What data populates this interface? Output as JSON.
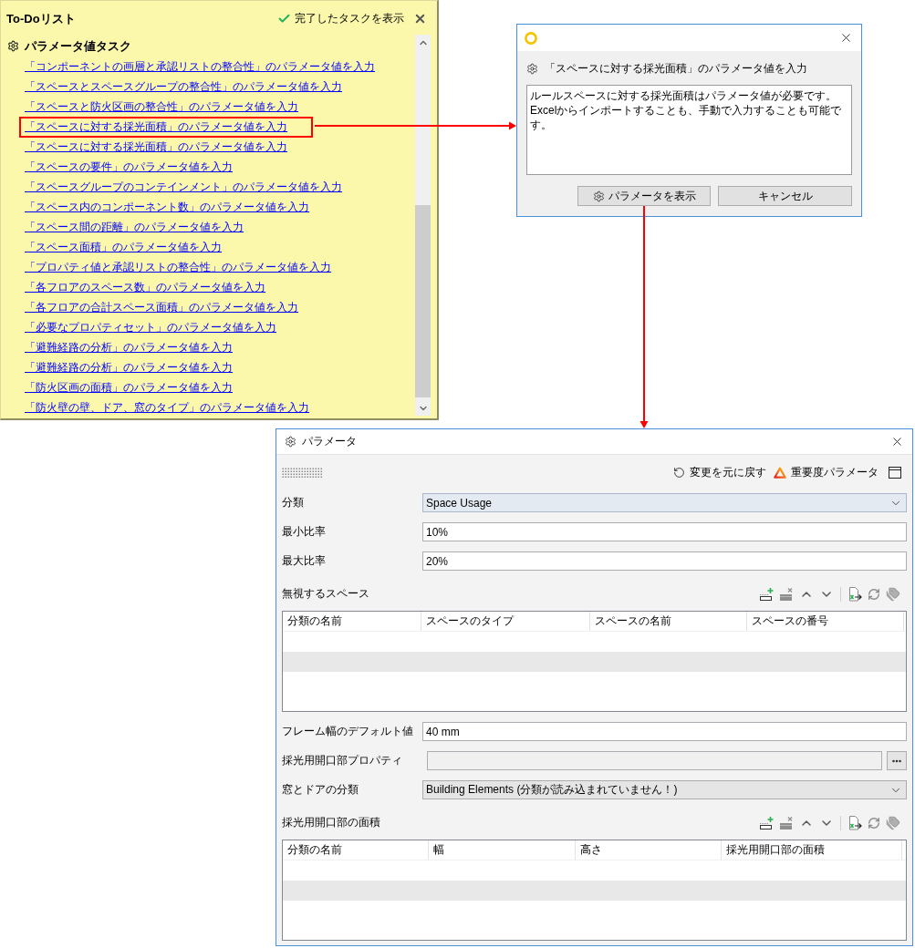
{
  "todo": {
    "title": "To-Doリスト",
    "show_completed": {
      "label": "完了したタスクを表示",
      "checked": true
    },
    "section": {
      "title": "パラメータ値タスク"
    },
    "tasks": [
      {
        "label": "「コンポーネントの画層と承認リストの整合性」のパラメータ値を入力",
        "highlighted": false
      },
      {
        "label": "「スペースとスペースグループの整合性」のパラメータ値を入力",
        "highlighted": false
      },
      {
        "label": "「スペースと防火区画の整合性」のパラメータ値を入力",
        "highlighted": false
      },
      {
        "label": "「スペースに対する採光面積」のパラメータ値を入力",
        "highlighted": true
      },
      {
        "label": "「スペースに対する採光面積」のパラメータ値を入力",
        "highlighted": false
      },
      {
        "label": "「スペースの要件」のパラメータ値を入力",
        "highlighted": false
      },
      {
        "label": "「スペースグループのコンテインメント」のパラメータ値を入力",
        "highlighted": false
      },
      {
        "label": "「スペース内のコンポーネント数」のパラメータ値を入力",
        "highlighted": false
      },
      {
        "label": "「スペース間の距離」のパラメータ値を入力",
        "highlighted": false
      },
      {
        "label": "「スペース面積」のパラメータ値を入力",
        "highlighted": false
      },
      {
        "label": "「プロパティ値と承認リストの整合性」のパラメータ値を入力",
        "highlighted": false
      },
      {
        "label": "「各フロアのスペース数」のパラメータ値を入力",
        "highlighted": false
      },
      {
        "label": "「各フロアの合計スペース面積」のパラメータ値を入力",
        "highlighted": false
      },
      {
        "label": "「必要なプロパティセット」のパラメータ値を入力",
        "highlighted": false
      },
      {
        "label": "「避難経路の分析」のパラメータ値を入力",
        "highlighted": false
      },
      {
        "label": "「避難経路の分析」のパラメータ値を入力",
        "highlighted": false
      },
      {
        "label": "「防火区画の面積」のパラメータ値を入力",
        "highlighted": false
      },
      {
        "label": "「防火壁の壁、ドア、窓のタイプ」のパラメータ値を入力",
        "highlighted": false
      }
    ]
  },
  "dialog": {
    "heading": "「スペースに対する採光面積」のパラメータ値を入力",
    "message": "ルールスペースに対する採光面積はパラメータ値が必要です。Excelからインポートすることも、手動で入力することも可能です。",
    "buttons": [
      {
        "label": "パラメータを表示",
        "kind": "with_icon"
      },
      {
        "label": "キャンセル",
        "kind": "plain"
      }
    ]
  },
  "parameters": {
    "title": "パラメータ",
    "toolbar": {
      "revert": "変更を元に戻す",
      "severity": "重要度パラメータ"
    },
    "fields": [
      {
        "kind": "dropdown",
        "label": "分類",
        "value": "Space Usage",
        "focused": true
      },
      {
        "kind": "text",
        "label": "最小比率",
        "value": "10%"
      },
      {
        "kind": "text",
        "label": "最大比率",
        "value": "20%"
      },
      {
        "kind": "table",
        "label": "無視するスペース",
        "columns": [
          "分類の名前",
          "スペースのタイプ",
          "スペースの名前",
          "スペースの番号"
        ]
      },
      {
        "kind": "text",
        "label": "フレーム幅のデフォルト値",
        "value": "40 mm"
      },
      {
        "kind": "browse",
        "label": "採光用開口部プロパティ",
        "disabled": true
      },
      {
        "kind": "dropdown",
        "label": "窓とドアの分類",
        "value": "Building Elements (分類が読み込まれていません！)",
        "focused": false
      },
      {
        "kind": "table",
        "label": "採光用開口部の面積",
        "columns": [
          "分類の名前",
          "幅",
          "高さ",
          "採光用開口部の面積"
        ]
      }
    ]
  }
}
